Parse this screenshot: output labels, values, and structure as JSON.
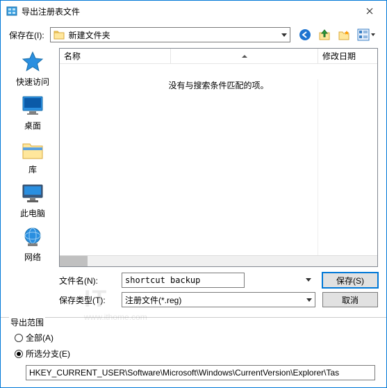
{
  "titlebar": {
    "title": "导出注册表文件"
  },
  "top": {
    "save_in_label": "保存在(I):",
    "location": "新建文件夹",
    "nav": {
      "back": "back-icon",
      "up": "up-icon",
      "newfolder": "new-folder-icon",
      "view": "view-icon"
    }
  },
  "places": [
    {
      "key": "quickaccess",
      "label": "快速访问"
    },
    {
      "key": "desktop",
      "label": "桌面"
    },
    {
      "key": "libraries",
      "label": "库"
    },
    {
      "key": "thispc",
      "label": "此电脑"
    },
    {
      "key": "network",
      "label": "网络"
    }
  ],
  "listview": {
    "col_name": "名称",
    "col_date": "修改日期",
    "empty_msg": "没有与搜索条件匹配的项。"
  },
  "form": {
    "filename_label": "文件名(N):",
    "filename_value": "shortcut backup",
    "filetype_label": "保存类型(T):",
    "filetype_value": "注册文件(*.reg)",
    "save_btn": "保存(S)",
    "cancel_btn": "取消"
  },
  "export": {
    "section_title": "导出范围",
    "opt_all": "全部(A)",
    "opt_branch": "所选分支(E)",
    "branch_path": "HKEY_CURRENT_USER\\Software\\Microsoft\\Windows\\CurrentVersion\\Explorer\\Tas"
  },
  "watermark": {
    "main": "IT",
    "sub": "www.ithome.com"
  }
}
